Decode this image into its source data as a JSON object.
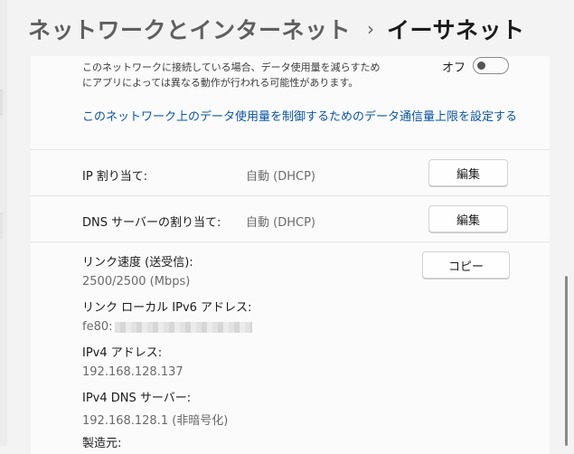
{
  "breadcrumb": {
    "parent": "ネットワークとインターネット",
    "separator": "›",
    "current": "イーサネット"
  },
  "metered": {
    "description_line1": "このネットワークに接続している場合、データ使用量を減らすため",
    "description_line2": "にアプリによっては異なる動作が行われる可能性があります。",
    "toggle_label": "オフ",
    "toggle_on": false,
    "link": "このネットワーク上のデータ使用量を制御するためのデータ通信量上限を設定する"
  },
  "ip_assignment": {
    "label": "IP 割り当て:",
    "value": "自動 (DHCP)",
    "button": "編集"
  },
  "dns_assignment": {
    "label": "DNS サーバーの割り当て:",
    "value": "自動 (DHCP)",
    "button": "編集"
  },
  "properties": {
    "copy_button": "コピー",
    "link_speed_label": "リンク速度 (送受信):",
    "link_speed_value": "2500/2500 (Mbps)",
    "ipv6_label": "リンク ローカル IPv6 アドレス:",
    "ipv6_value_prefix": "fe80:",
    "ipv4_label": "IPv4 アドレス:",
    "ipv4_value": "192.168.128.137",
    "ipv4_dns_label": "IPv4 DNS サーバー:",
    "ipv4_dns_value": "192.168.128.1 (非暗号化)",
    "manufacturer_label": "製造元:"
  },
  "colors": {
    "link": "#0a56a5",
    "panel": "#fbfbfb",
    "background": "#f3f3f3"
  }
}
